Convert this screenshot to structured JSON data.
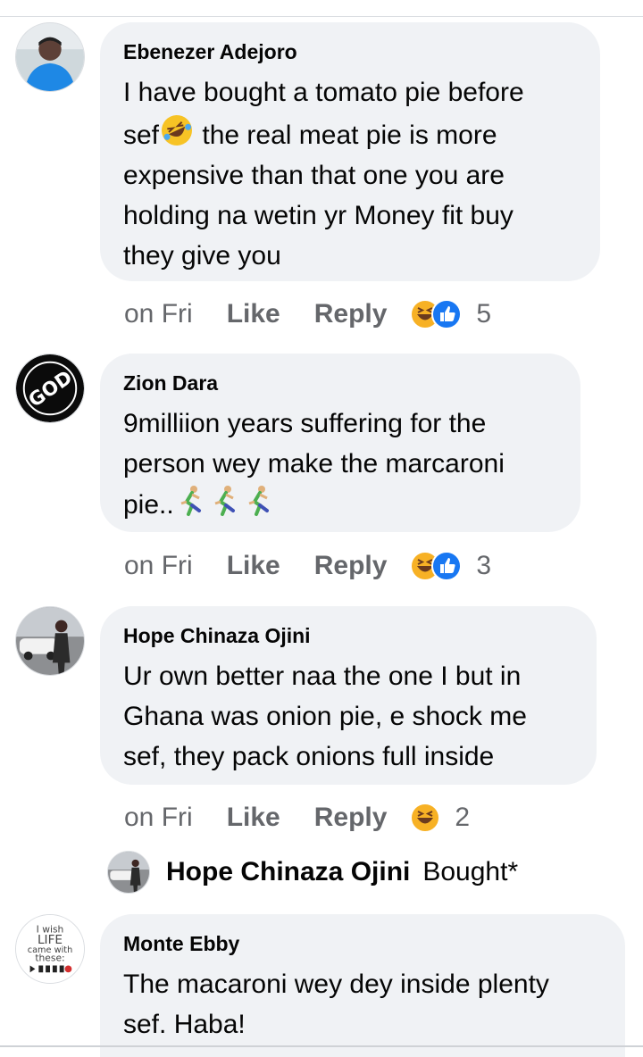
{
  "comments": [
    {
      "author": "Ebenezer Adejoro",
      "text_lines": [
        "I have bought a tomato pie before",
        "sef",
        " the real meat pie is more",
        "expensive than that one you are",
        "holding na wetin yr Money fit buy",
        "they give you"
      ],
      "time": "on Fri",
      "like": "Like",
      "reply": "Reply",
      "reactions": [
        "laughing-face-icon",
        "thumbs-up-icon"
      ],
      "reaction_count": "5"
    },
    {
      "author": "Zion Dara",
      "text_lines": [
        "9milliion years suffering for the",
        "person wey make the marcaroni",
        "pie.."
      ],
      "time": "on Fri",
      "like": "Like",
      "reply": "Reply",
      "reactions": [
        "laughing-face-icon",
        "thumbs-up-icon"
      ],
      "reaction_count": "3"
    },
    {
      "author": "Hope Chinaza Ojini",
      "text_lines": [
        "Ur own better naa the one I but in",
        "Ghana was onion pie, e shock me",
        "sef, they pack onions full inside"
      ],
      "time": "on Fri",
      "like": "Like",
      "reply": "Reply",
      "reactions": [
        "laughing-face-icon"
      ],
      "reaction_count": "2"
    },
    {
      "author": "Monte Ebby",
      "text_lines": [
        "The macaroni wey dey inside plenty",
        "sef. Haba!"
      ]
    }
  ],
  "reply_preview": {
    "author": "Hope Chinaza Ojini",
    "text": "Bought*"
  },
  "avatar_text": {
    "zion": "GOD",
    "monte_line1": "I wish",
    "monte_line2": "LIFE",
    "monte_line3": "came with",
    "monte_line4": "these:"
  },
  "colors": {
    "bubble": "#f0f2f5",
    "meta_text": "#65676b",
    "like_blue": "#1877f2",
    "haha_yellow": "#f7b125"
  }
}
